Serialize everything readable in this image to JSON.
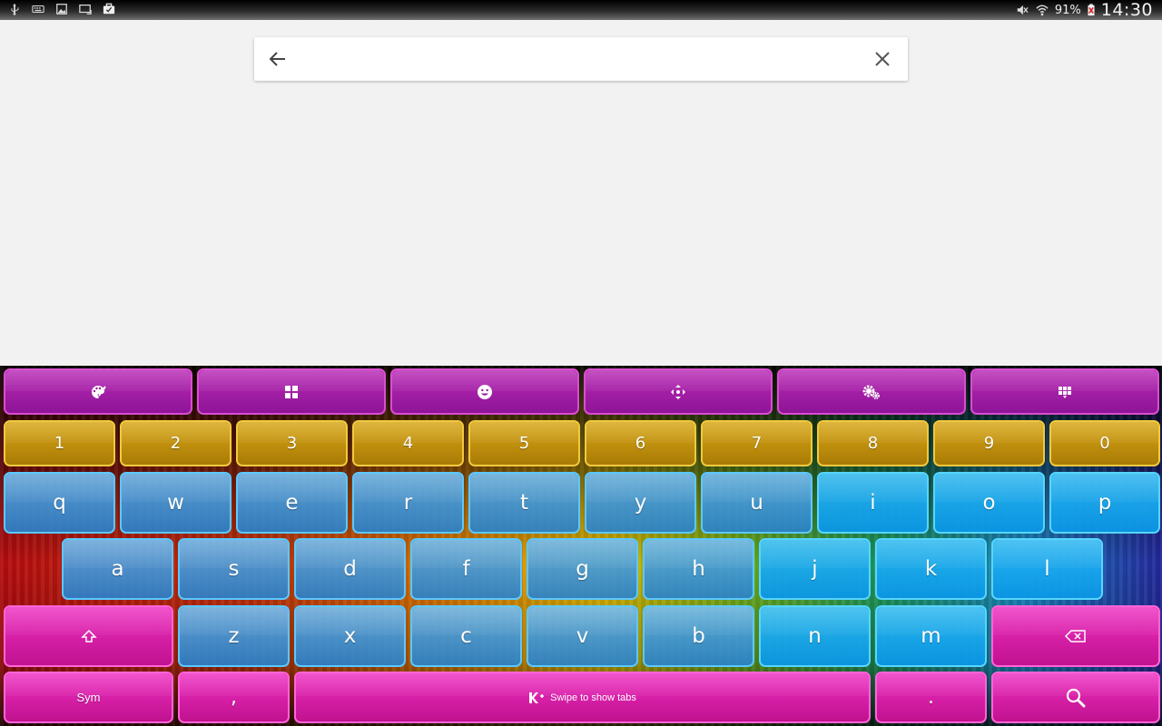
{
  "status_bar": {
    "icons_left": [
      "usb-icon",
      "keyboard-icon",
      "image-icon",
      "cast-icon",
      "briefcase-icon"
    ],
    "icons_right": [
      "mute-icon",
      "wifi-icon",
      "battery-icon"
    ],
    "battery_percent": "91%",
    "time": "14:30"
  },
  "search": {
    "back_icon": "arrow-left-icon",
    "placeholder": "",
    "value": "",
    "clear_icon": "close-icon"
  },
  "keyboard": {
    "toolbar": [
      {
        "name": "palette-icon"
      },
      {
        "name": "numpad-icon"
      },
      {
        "name": "emoji-icon"
      },
      {
        "name": "move-arrows-icon"
      },
      {
        "name": "gear-icon"
      },
      {
        "name": "apps-grid-icon"
      }
    ],
    "numbers": [
      "1",
      "2",
      "3",
      "4",
      "5",
      "6",
      "7",
      "8",
      "9",
      "0"
    ],
    "row1": [
      "q",
      "w",
      "e",
      "r",
      "t",
      "y",
      "u",
      "i",
      "o",
      "p"
    ],
    "row2": [
      "a",
      "s",
      "d",
      "f",
      "g",
      "h",
      "j",
      "k",
      "l"
    ],
    "row3": [
      "z",
      "x",
      "c",
      "v",
      "b",
      "n",
      "m"
    ],
    "shift_icon": "shift-up-icon",
    "backspace_icon": "backspace-icon",
    "sym_label": "Sym",
    "comma_label": ",",
    "space_label": "Swipe to show tabs",
    "period_label": ".",
    "search_icon": "search-icon",
    "colors": {
      "purple": "#a51fa5",
      "gold": "#c6950d",
      "blue": "#3aa3e6",
      "magenta": "#e01fb0"
    }
  }
}
